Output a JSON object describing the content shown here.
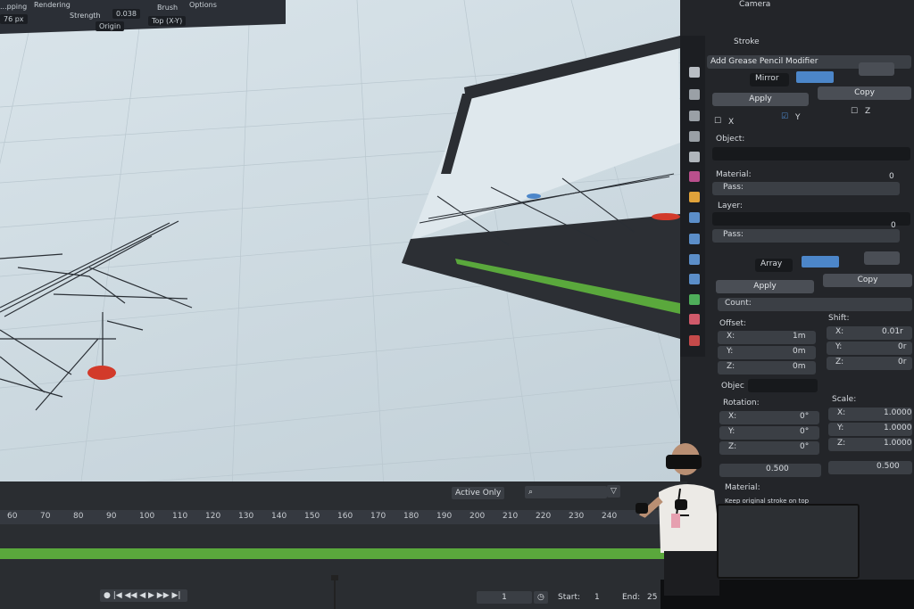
{
  "top_toolbar": {
    "mode_left": "...pping",
    "rendering": "Rendering",
    "radius": "76 px",
    "strength_label": "Strength",
    "strength_value": "0.038",
    "brush": "Brush",
    "options": "Options",
    "origin": "Origin",
    "view": "Top (X-Y)"
  },
  "panel": {
    "camera": "Camera",
    "stroke": "Stroke",
    "add_modifier": "Add Grease Pencil Modifier",
    "mirror": {
      "name": "Mirror",
      "apply": "Apply",
      "copy": "Copy",
      "x": "X",
      "y": "Y",
      "z": "Z",
      "object": "Object:",
      "material": "Material:",
      "pass_label": "Pass:",
      "pass_value": "0",
      "layer": "Layer:",
      "pass2_label": "Pass:",
      "pass2_value": "0"
    },
    "array": {
      "name": "Array",
      "apply": "Apply",
      "copy": "Copy",
      "count": "Count:",
      "offset": "Offset:",
      "shift": "Shift:",
      "offset_x": "1m",
      "offset_y": "0m",
      "offset_z": "0m",
      "shift_x": "0.01r",
      "shift_y": "0r",
      "shift_z": "0r",
      "objec": "Objec",
      "rotation": "Rotation:",
      "scale": "Scale:",
      "rot_x": "0°",
      "rot_y": "0°",
      "rot_z": "0°",
      "scale_x": "1.0000",
      "scale_y": "1.0000",
      "scale_z": "1.0000",
      "rand1": "0.500",
      "rand2": "0.500",
      "material": "Material:",
      "keep": "Keep original stroke on top"
    },
    "axis_x": "X:",
    "axis_y": "Y:",
    "axis_z": "Z:"
  },
  "timeline": {
    "active_only": "Active Only",
    "ticks": [
      "60",
      "70",
      "80",
      "90",
      "100",
      "110",
      "120",
      "130",
      "140",
      "150",
      "160",
      "170",
      "180",
      "190",
      "200",
      "210",
      "220",
      "230",
      "240"
    ],
    "current_frame": "1",
    "start_label": "Start:",
    "start_value": "1",
    "end_label": "End:",
    "end_value": "25"
  },
  "colors": {
    "viewport": "#d3dfe5",
    "panel": "#232529",
    "accent_blue": "#4c86c9",
    "timeline_green": "#5aa83c",
    "origin_red": "#d23a2a"
  }
}
